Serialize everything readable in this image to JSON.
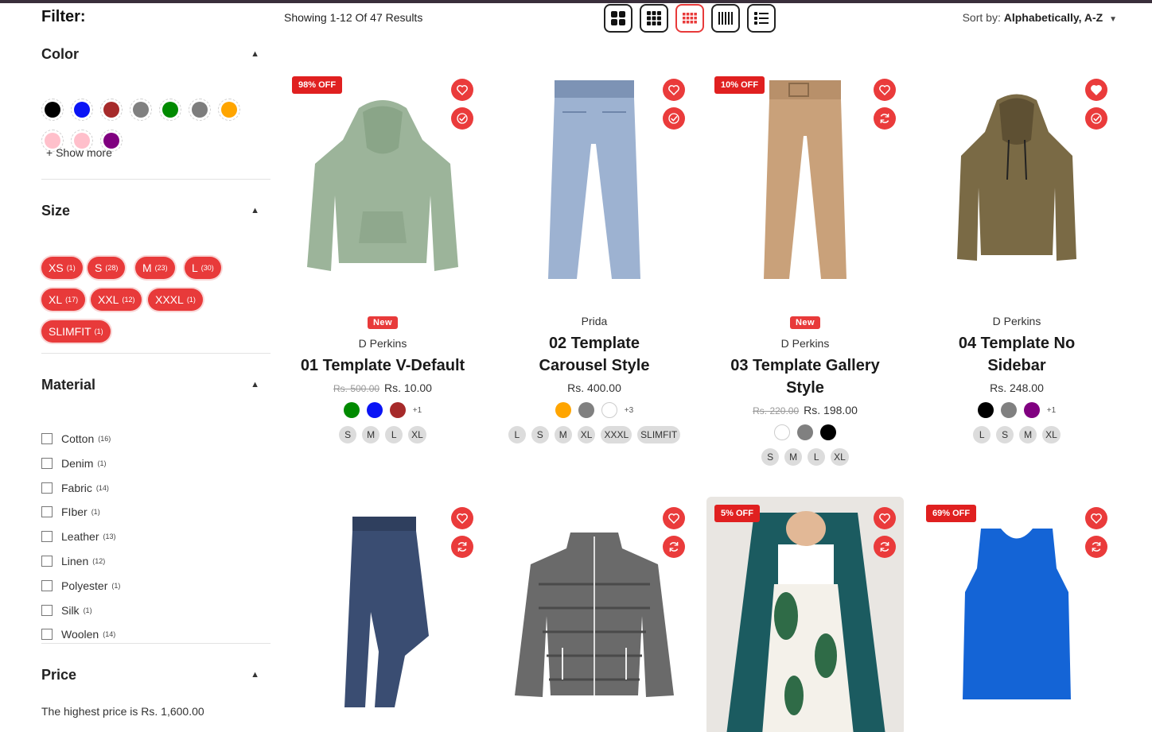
{
  "filters": {
    "title": "Filter:",
    "color": {
      "title": "Color",
      "swatches": [
        {
          "name": "black",
          "hex": "#000000"
        },
        {
          "name": "blue",
          "hex": "#0a14f5"
        },
        {
          "name": "brown",
          "hex": "#a62a2a"
        },
        {
          "name": "gray",
          "hex": "#808080"
        },
        {
          "name": "green",
          "hex": "#008a00"
        },
        {
          "name": "grey",
          "hex": "#7d7d7d"
        },
        {
          "name": "orange",
          "hex": "#ffa500"
        },
        {
          "name": "pink",
          "hex": "#ffc0cb"
        },
        {
          "name": "light-pink",
          "hex": "#ffbfcb"
        },
        {
          "name": "purple",
          "hex": "#800080"
        }
      ],
      "show_more": "+ Show more"
    },
    "size": {
      "title": "Size",
      "options": [
        {
          "label": "XS",
          "count": "(1)"
        },
        {
          "label": "S",
          "count": "(28)"
        },
        {
          "label": "M",
          "count": "(23)"
        },
        {
          "label": "L",
          "count": "(30)"
        },
        {
          "label": "XL",
          "count": "(17)"
        },
        {
          "label": "XXL",
          "count": "(12)"
        },
        {
          "label": "XXXL",
          "count": "(1)"
        },
        {
          "label": "SLIMFIT",
          "count": "(1)"
        }
      ]
    },
    "material": {
      "title": "Material",
      "options": [
        {
          "label": "Cotton",
          "count": "(16)"
        },
        {
          "label": "Denim",
          "count": "(1)"
        },
        {
          "label": "Fabric",
          "count": "(14)"
        },
        {
          "label": "FIber",
          "count": "(1)"
        },
        {
          "label": "Leather",
          "count": "(13)"
        },
        {
          "label": "Linen",
          "count": "(12)"
        },
        {
          "label": "Polyester",
          "count": "(1)"
        },
        {
          "label": "Silk",
          "count": "(1)"
        },
        {
          "label": "Woolen",
          "count": "(14)"
        }
      ]
    },
    "price": {
      "title": "Price",
      "highest_text": "The highest price is Rs. 1,600.00"
    }
  },
  "toolbar": {
    "results": "Showing 1-12 Of 47 Results",
    "sort_label": "Sort by:",
    "sort_value": "Alphabetically, A-Z"
  },
  "products": [
    {
      "badge": "98% OFF",
      "tag": "New",
      "vendor": "D Perkins",
      "name": "01 Template V-Default",
      "compare_price": "Rs. 500.00",
      "price": "Rs. 10.00",
      "colors": [
        "#008a00",
        "#0a14f5",
        "#a62a2a"
      ],
      "more_colors": "+1",
      "sizes": [
        "S",
        "M",
        "L",
        "XL"
      ]
    },
    {
      "badge": "",
      "tag": "",
      "vendor": "Prida",
      "name": "02 Template Carousel Style",
      "compare_price": "",
      "price": "Rs. 400.00",
      "colors": [
        "#ffa500",
        "#808080",
        "#ffffff"
      ],
      "more_colors": "+3",
      "sizes": [
        "L",
        "S",
        "M",
        "XL",
        "XXXL",
        "SLIMFIT"
      ]
    },
    {
      "badge": "10% OFF",
      "tag": "New",
      "vendor": "D Perkins",
      "name": "03 Template Gallery Style",
      "compare_price": "Rs. 220.00",
      "price": "Rs. 198.00",
      "colors": [
        "#ffffff",
        "#808080",
        "#000000"
      ],
      "more_colors": "",
      "sizes": [
        "S",
        "M",
        "L",
        "XL"
      ]
    },
    {
      "badge": "",
      "tag": "",
      "vendor": "D Perkins",
      "name": "04 Template No Sidebar",
      "compare_price": "",
      "price": "Rs. 248.00",
      "colors": [
        "#000000",
        "#808080",
        "#800080"
      ],
      "more_colors": "+1",
      "sizes": [
        "L",
        "S",
        "M",
        "XL"
      ]
    },
    {
      "badge": ""
    },
    {
      "badge": ""
    },
    {
      "badge": "5% OFF"
    },
    {
      "badge": "69% OFF"
    }
  ]
}
